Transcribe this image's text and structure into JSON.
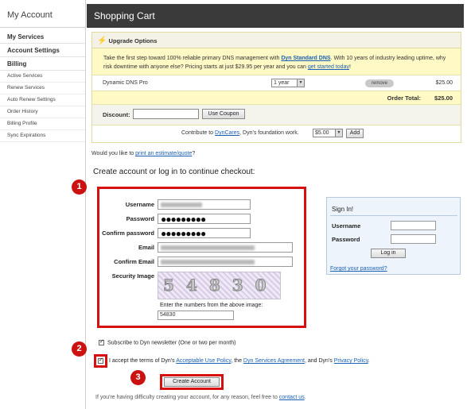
{
  "sidebar": {
    "title": "My Account",
    "sections": [
      {
        "label": "My Services"
      },
      {
        "label": "Account Settings"
      },
      {
        "label": "Billing"
      }
    ],
    "billing_items": [
      {
        "label": "Active Services"
      },
      {
        "label": "Renew Services"
      },
      {
        "label": "Auto Renew Settings"
      },
      {
        "label": "Order History"
      },
      {
        "label": "Billing Profile"
      },
      {
        "label": "Sync Expirations"
      }
    ]
  },
  "header": {
    "title": "Shopping Cart"
  },
  "cart": {
    "upgrade_title": "Upgrade Options",
    "promo_text_1": "Take the first step toward 100% reliable primary DNS management with ",
    "promo_link_1": "Dyn Standard DNS",
    "promo_text_2": ". With 10 years of industry leading uptime, why risk downtime with anyone else? Pricing starts at just $29.95 per year and you can ",
    "promo_link_2": "get started today",
    "promo_text_3": "!",
    "item_name": "Dynamic DNS Pro",
    "item_term": "1 year",
    "remove_label": "remove",
    "item_price": "$25.00",
    "total_label": "Order Total:",
    "total_value": "$25.00",
    "discount_label": "Discount:",
    "discount_value": "",
    "use_coupon_label": "Use Coupon",
    "contrib_text_1": "Contribute to ",
    "contrib_link": "DynCares",
    "contrib_text_2": ", Dyn's foundation work.",
    "contrib_amount": "$5.00",
    "add_label": "Add"
  },
  "estimate": {
    "text": "Would you like to ",
    "link": "print an estimate/quote",
    "end": "?"
  },
  "checkout_heading": "Create account or log in to continue checkout:",
  "markers": {
    "one": "1",
    "two": "2",
    "three": "3"
  },
  "form": {
    "username_label": "Username",
    "password_label": "Password",
    "password_value": "●●●●●●●●●",
    "confirm_password_label": "Confirm password",
    "confirm_password_value": "●●●●●●●●●",
    "email_label": "Email",
    "confirm_email_label": "Confirm Email",
    "security_label": "Security Image",
    "captcha_digits": "54830",
    "captcha_hint": "Enter the numbers from the above image:",
    "captcha_value": "54830"
  },
  "signin": {
    "title": "Sign In!",
    "username_label": "Username",
    "password_label": "Password",
    "button_label": "Log in",
    "forgot_link": "Forgot your password?"
  },
  "newsletter_label": "Subscribe to Dyn newsletter (One or two per month)",
  "terms": {
    "text_1": "I accept the terms of Dyn's ",
    "link_1": "Acceptable Use Policy",
    "text_2": ", the ",
    "link_2": "Dyn Services Agreement",
    "text_3": ", and Dyn's ",
    "link_3": "Privacy Policy",
    "text_4": "."
  },
  "create_account_label": "Create Account",
  "trouble": {
    "text": "If you're having difficulty creating your account, for any reason, feel free to ",
    "link": "contact us",
    "end": "."
  },
  "colors": {
    "accent_red": "#d60f0f",
    "header_bg": "#3a3a3a",
    "promo_bg": "#fff9c6",
    "signin_bg": "#eef4fb"
  }
}
